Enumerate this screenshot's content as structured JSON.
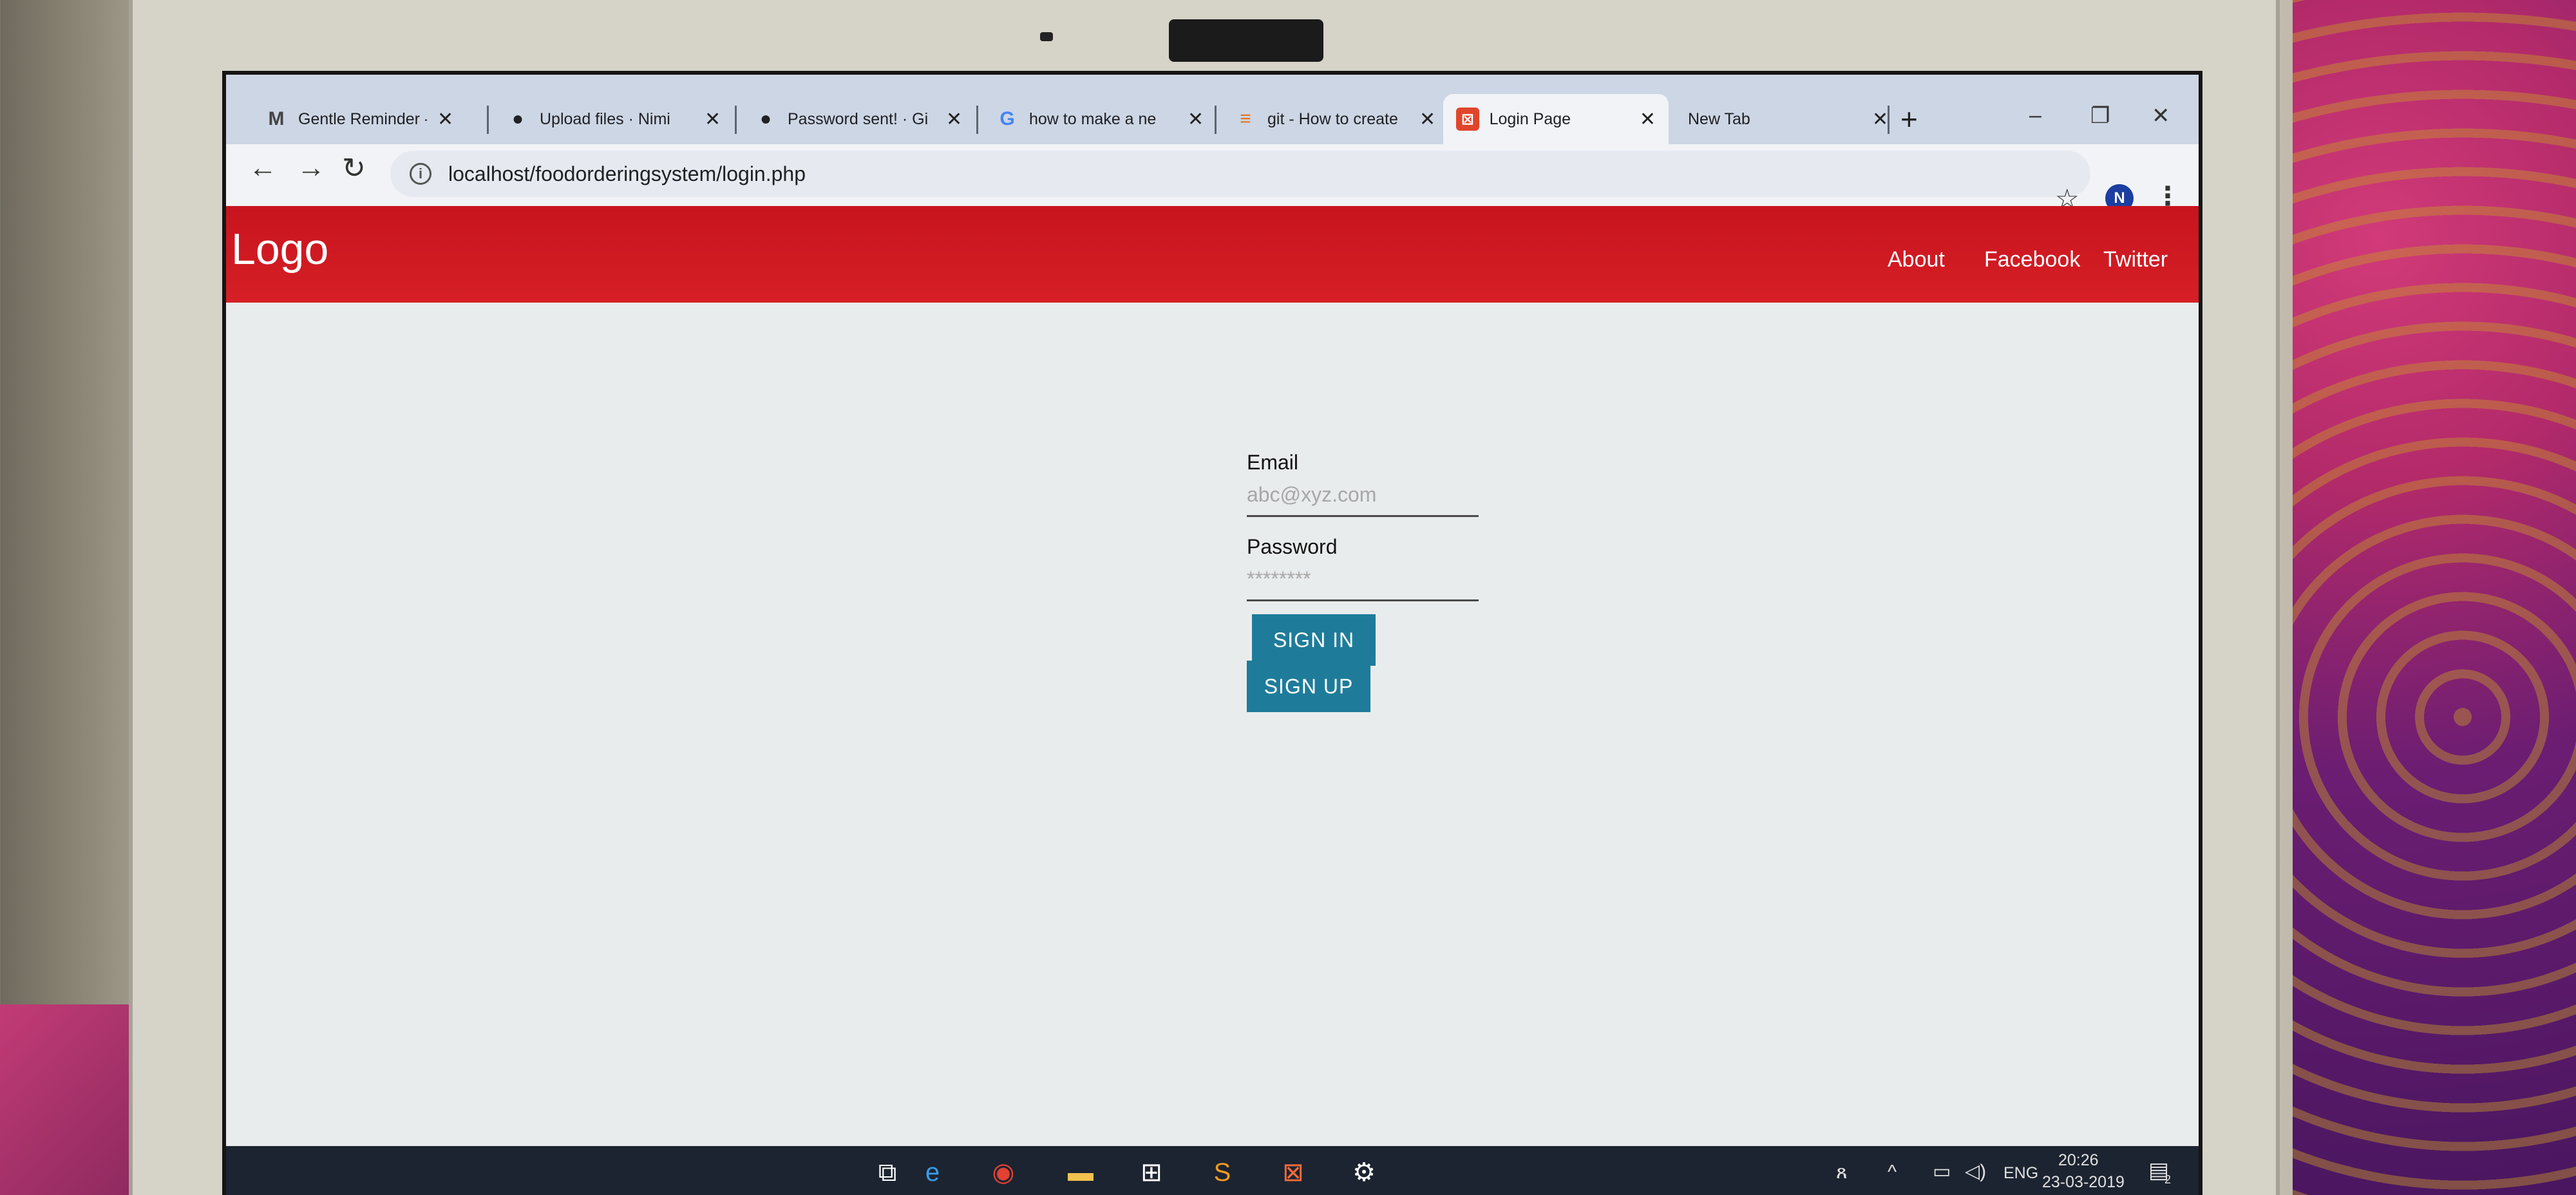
{
  "browser": {
    "tabs": [
      {
        "title": "Gentle Reminder -",
        "icon": "gmail-icon",
        "active": false
      },
      {
        "title": "Upload files · Nimi",
        "icon": "github-icon",
        "active": false
      },
      {
        "title": "Password sent! · Gi",
        "icon": "github-icon",
        "active": false
      },
      {
        "title": "how to make a ne",
        "icon": "google-icon",
        "active": false
      },
      {
        "title": "git - How to create",
        "icon": "stackoverflow-icon",
        "active": false
      },
      {
        "title": "Login Page",
        "icon": "xampp-icon",
        "active": true
      },
      {
        "title": "New Tab",
        "icon": "",
        "active": false
      }
    ],
    "url": "localhost/foodorderingsystem/login.php",
    "profile_initial": "N"
  },
  "site": {
    "logo": "Logo",
    "nav": [
      "About",
      "Facebook",
      "Twitter"
    ],
    "header_color": "#d61f26"
  },
  "login": {
    "email_label": "Email",
    "email_placeholder": "abc@xyz.com",
    "password_label": "Password",
    "password_placeholder": "********",
    "signin_label": "SIGN IN",
    "signup_label": "SIGN UP",
    "button_color": "#1e7c9a"
  },
  "taskbar": {
    "language": "ENG",
    "time": "20:26",
    "date": "23-03-2019",
    "notification_count": "2"
  }
}
